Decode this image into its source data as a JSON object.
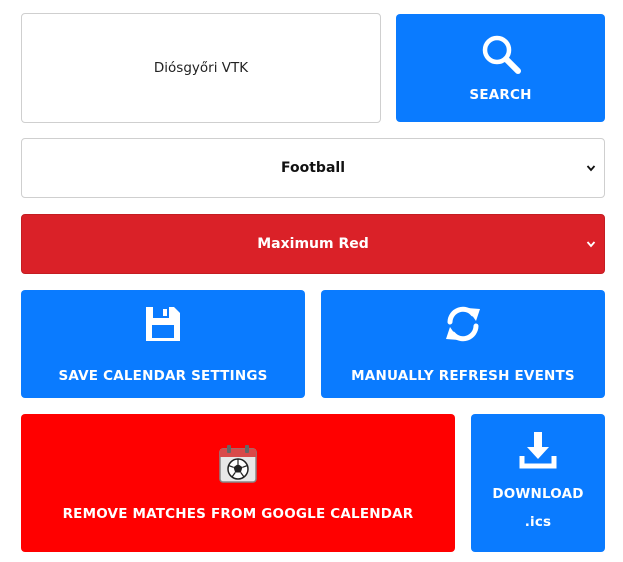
{
  "search": {
    "value": "Diósgyőri VTK",
    "button_label": "SEARCH"
  },
  "sport_select": {
    "selected": "Football"
  },
  "color_select": {
    "selected": "Maximum Red",
    "color": "#da2128"
  },
  "actions": {
    "save_label": "SAVE CALENDAR SETTINGS",
    "refresh_label": "MANUALLY REFRESH EVENTS",
    "remove_label": "REMOVE MATCHES FROM GOOGLE CALENDAR",
    "download_label": "DOWNLOAD",
    "download_ext": ".ics"
  },
  "colors": {
    "primary": "#0a7bff",
    "danger": "#ff0000"
  },
  "icons": {
    "search": "search-icon",
    "save": "floppy-disk-icon",
    "refresh": "refresh-icon",
    "remove": "calendar-football-icon",
    "download": "download-icon"
  }
}
